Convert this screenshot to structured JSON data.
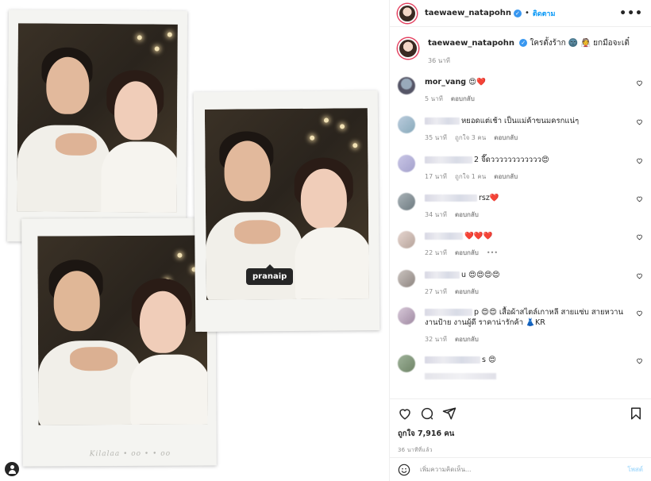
{
  "post": {
    "image_tag": "pranaip",
    "polaroid_caption": "Kilalaa • oo • • oo"
  },
  "header": {
    "username": "taewaew_natapohn",
    "separator": "•",
    "follow_label": "ติดตาม",
    "more_label": "•••"
  },
  "caption": {
    "username": "taewaew_natapohn",
    "text": "ใครตั้งร้าก 🌚 👰 ยกมือจะเติ๋",
    "time": "36 นาที"
  },
  "comments": [
    {
      "username": "mor_vang",
      "text": "😍❤️",
      "time": "5 นาที",
      "likes": "",
      "reply": "ตอบกลับ"
    },
    {
      "username": "",
      "text": "หยอดแต่เช้า เป็นแม่ค้าขนมครกแน่ๆ",
      "time": "35 นาที",
      "likes": "ถูกใจ 3 คน",
      "reply": "ตอบกลับ"
    },
    {
      "username": "",
      "text": "2 จี๊ดวววววววววววว😍",
      "time": "17 นาที",
      "likes": "ถูกใจ 1 คน",
      "reply": "ตอบกลับ"
    },
    {
      "username": "",
      "text": "rsz❤️",
      "time": "34 นาที",
      "likes": "",
      "reply": "ตอบกลับ"
    },
    {
      "username": "",
      "text": "❤️❤️❤️",
      "time": "22 นาที",
      "likes": "",
      "reply": "ตอบกลับ",
      "extra": "•••"
    },
    {
      "username": "",
      "text": "u 😍😍😍😍",
      "time": "27 นาที",
      "likes": "",
      "reply": "ตอบกลับ"
    },
    {
      "username": "",
      "text": "p 😍😍 เสื้อผ้าสไตล์เกาหลี สายแซ่บ สายหวาน งานป้าย งานผู้ดี ราคาน่ารักค้า 👗KR",
      "time": "32 นาที",
      "likes": "",
      "reply": "ตอบกลับ"
    },
    {
      "username": "",
      "text": "s 😍",
      "time": "",
      "likes": "",
      "reply": ""
    }
  ],
  "actions": {
    "like_count": "ถูกใจ 7,916 คน",
    "time_ago": "36 นาทีที่แล้ว"
  },
  "add_comment": {
    "placeholder": "เพิ่มความคิดเห็น...",
    "post_label": "โพสต์"
  },
  "icons": {
    "heart": "heart-icon",
    "comment": "comment-icon",
    "share": "share-icon",
    "save": "bookmark-icon",
    "emoji": "emoji-icon",
    "user_tag": "user-tag-icon"
  },
  "colors": {
    "accent": "#0095f6",
    "verified": "#3897f0",
    "text": "#262626",
    "secondary": "#8e8e8e",
    "story_ring": "#e4405f"
  }
}
